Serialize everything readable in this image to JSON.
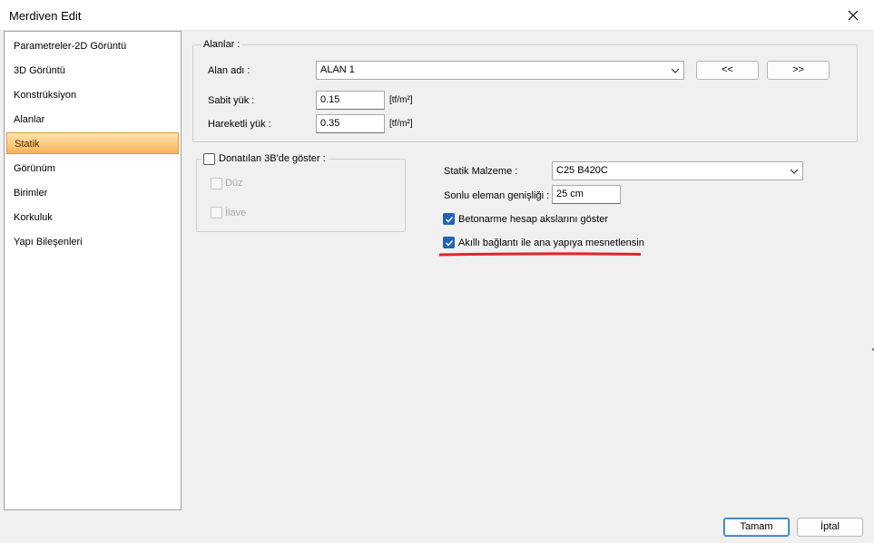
{
  "window": {
    "title": "Merdiven Edit",
    "close_icon": "close-icon"
  },
  "sidebar": {
    "items": [
      {
        "label": "Parametreler-2D Görüntü",
        "selected": false
      },
      {
        "label": "3D Görüntü",
        "selected": false
      },
      {
        "label": "Konstrüksiyon",
        "selected": false
      },
      {
        "label": "Alanlar",
        "selected": false
      },
      {
        "label": "Statik",
        "selected": true
      },
      {
        "label": "Görünüm",
        "selected": false
      },
      {
        "label": "Birimler",
        "selected": false
      },
      {
        "label": "Korkuluk",
        "selected": false
      },
      {
        "label": "Yapı Bileşenleri",
        "selected": false
      }
    ]
  },
  "alanlar_group": {
    "title": "Alanlar :",
    "alan_adi_label": "Alan adı :",
    "alan_adi_value": "ALAN 1",
    "prev_button": "<<",
    "next_button": ">>",
    "sabit_yuk_label": "Sabit yük :",
    "sabit_yuk_value": "0.15",
    "sabit_yuk_unit": "[tf/m²]",
    "hareketli_yuk_label": "Hareketli yük :",
    "hareketli_yuk_value": "0.35",
    "hareketli_yuk_unit": "[tf/m²]"
  },
  "donatilan_group": {
    "title": "Donatılan 3B'de göster :",
    "checked": false,
    "duz_label": "Düz",
    "ilave_label": "İlave"
  },
  "statik": {
    "malzeme_label": "Statik Malzeme :",
    "malzeme_value": "C25 B420C",
    "sonlu_label": "Sonlu eleman genişliği :",
    "sonlu_value": "25 cm",
    "betonarme_label": "Betonarme hesap akslarını göster",
    "betonarme_checked": true,
    "akilli_label": "Akıllı bağlantı ile ana yapıya mesnetlensin",
    "akilli_checked": true
  },
  "footer": {
    "ok_label": "Tamam",
    "cancel_label": "İptal"
  },
  "colors": {
    "selected_item": "#f8b35a",
    "checkbox_checked": "#2164b6",
    "annotation": "#e8202a"
  }
}
